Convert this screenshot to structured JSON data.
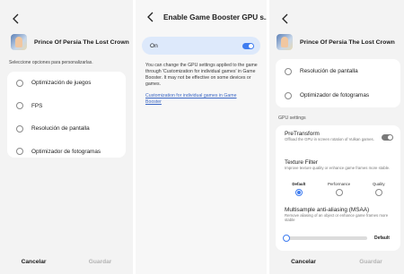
{
  "panel1": {
    "game_title": "Prince Of Persia The Lost Crown",
    "hint": "Seleccione opciones para personalizarlas.",
    "options": [
      {
        "label": "Optimización de juegos"
      },
      {
        "label": "FPS"
      },
      {
        "label": "Resolución de pantalla"
      },
      {
        "label": "Optimizador de fotogramas"
      }
    ],
    "cancel_label": "Cancelar",
    "save_label": "Guardar"
  },
  "panel2": {
    "title": "Enable Game Booster GPU s...",
    "toggle_label": "On",
    "toggle_on": true,
    "description": "You can change the GPU settings applied to the game through 'Customization for individual games' in Game Booster. It may not be effective on some devices or games.",
    "link": "Customization for individual games in Game Booster"
  },
  "panel3": {
    "game_title": "Prince Of Persia The Lost Crown",
    "options": [
      {
        "label": "Resolución de pantalla"
      },
      {
        "label": "Optimizador de fotogramas"
      }
    ],
    "section_label": "GPU settings",
    "pretransform": {
      "title": "PreTransform",
      "subtitle": "Offload the GPU in screen rotation of Vulkan games.",
      "enabled": false
    },
    "texture_filter": {
      "title": "Texture Filter",
      "subtitle": "Improve texture quality or enhance game frames more stable.",
      "choices": [
        "Default",
        "Performance",
        "Quality"
      ],
      "selected": "Default"
    },
    "msaa": {
      "title": "Multisample anti-aliasing (MSAA)",
      "subtitle": "Remove aliasing of an object or enhance game frames more stable",
      "value_label": "Default",
      "level": 0
    },
    "cancel_label": "Cancelar",
    "save_label": "Guardar"
  },
  "colors": {
    "accent": "#3e7cf0",
    "toggle_bar": "#dde9fb",
    "link": "#3a66c4"
  }
}
